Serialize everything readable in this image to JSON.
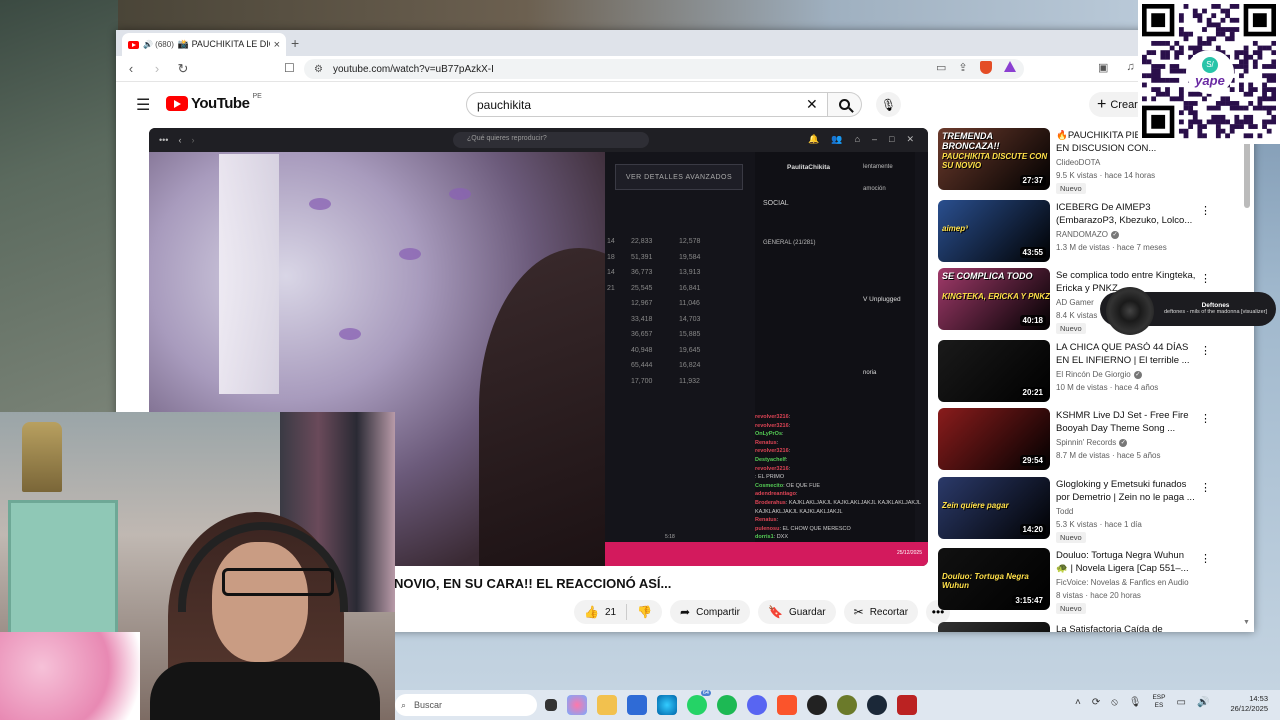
{
  "browser": {
    "tab": {
      "audio_badge": "🔊 (680)",
      "title": "📸 PAUCHIKITA LE DIC",
      "close": "×"
    },
    "new_tab": "+",
    "url": "youtube.com/watch?v=uB77pAzkX-I"
  },
  "youtube": {
    "logo_word": "YouTube",
    "country": "PE",
    "search_query": "pauchikita",
    "create_label": "Crear"
  },
  "player": {
    "inner_search_placeholder": "¿Qué quieres reproducir?",
    "advanced_btn": "VER DETALLES AVANZADOS",
    "profile_name": "PaulitaChikita",
    "social_label": "SOCIAL",
    "friends_label": "GENERAL (21/281)",
    "side_labels": [
      "lentamente",
      "amoción",
      "V Unplugged",
      "noria"
    ],
    "stat_col1": [
      "14",
      "18",
      "",
      "",
      "",
      "",
      "14",
      "",
      "",
      "",
      "",
      "21"
    ],
    "stat_col2": [
      "22,833",
      "51,391",
      "36,773",
      "25,545",
      "12,967",
      "",
      "33,418",
      "36,657",
      "40,948",
      "65,444",
      "17,700"
    ],
    "stat_col3": [
      "12,578",
      "19,584",
      "13,913",
      "16,841",
      "11,046",
      "",
      "14,703",
      "15,885",
      "19,645",
      "16,824",
      "11,932"
    ],
    "chat": [
      {
        "user": "revolver3216",
        "msg": ":"
      },
      {
        "user": "revolver3216",
        "msg": ":"
      },
      {
        "user": "OnLyPrOs",
        "msg": ":"
      },
      {
        "user": "Renatus",
        "msg": ":"
      },
      {
        "user": "revolver3216",
        "msg": ":"
      },
      {
        "user": "Destyachelf",
        "msg": ":"
      },
      {
        "user": "revolver3216",
        "msg": ":"
      },
      {
        "user": "",
        "msg": ": EL PRIMO"
      },
      {
        "user": "Cosmecito",
        "msg": ": OE QUE FUE"
      },
      {
        "user": "adendreantiago",
        "msg": ":"
      },
      {
        "user": "Broderahus",
        "msg": ": KAJKLAKLJAKJL KAJKLAKLJAKJL KAJKLAKLJAKJL"
      },
      {
        "user": "",
        "msg": "KAJKLAKLJAKJL KAJKLAKLJAKJL"
      },
      {
        "user": "Renatus",
        "msg": ":"
      },
      {
        "user": "pulenosu",
        "msg": ": EL CHOW QUE MERESCO"
      },
      {
        "user": "dorris1",
        "msg": ": DXX"
      }
    ],
    "time_small": "5:18",
    "date_small": "25/12/2025"
  },
  "video": {
    "title": "NOVIO, EN SU CARA!! EL REACCIONÓ ASÍ...",
    "likes": "21",
    "share_label": "Compartir",
    "save_label": "Guardar",
    "clip_label": "Recortar",
    "more": "•••"
  },
  "recommendations": [
    {
      "thumb_text": "TREMENDA BRONCAZA!!",
      "thumb_sub": "PAUCHIKITA DISCUTE CON SU NOVIO",
      "duration": "27:37",
      "title": "🔥PAUCHIKITA PIE CONTROL EN DISCUSION CON...",
      "channel": "ClideoDOTA",
      "meta": "9.5 K vistas · hace 14 horas",
      "badge": "Nuevo",
      "verified": false,
      "thumb_color": "#6b3a2c"
    },
    {
      "thumb_text": "",
      "thumb_sub": "aimep³",
      "duration": "43:55",
      "title": "ICEBERG De AIMEP3 (EmbarazoP3, Kbezuko, Lolco...",
      "channel": "RANDOMAZO",
      "meta": "1.3 M de vistas · hace 7 meses",
      "badge": "",
      "verified": true,
      "thumb_color": "#2a4f8f"
    },
    {
      "thumb_text": "SE COMPLICA TODO",
      "thumb_sub": "KINGTEKA, ERICKA Y PNKZ",
      "duration": "40:18",
      "title": "Se complica todo entre Kingteka, Ericka y PNKZ...",
      "channel": "AD Gamer",
      "meta": "8.4 K vistas",
      "badge": "Nuevo",
      "verified": false,
      "thumb_color": "#a03a6a"
    },
    {
      "thumb_text": "",
      "thumb_sub": "",
      "duration": "20:21",
      "title": "LA CHICA QUE PASÓ 44 DÍAS EN EL INFIERNO | El terrible ...",
      "channel": "El Rincón De Giorgio",
      "meta": "10 M de vistas · hace 4 años",
      "badge": "",
      "verified": true,
      "thumb_color": "#1a1a1a"
    },
    {
      "thumb_text": "",
      "thumb_sub": "",
      "duration": "29:54",
      "title": "KSHMR Live DJ Set - Free Fire Booyah Day Theme Song ...",
      "channel": "Spinnin' Records",
      "meta": "8.7 M de vistas · hace 5 años",
      "badge": "",
      "verified": true,
      "thumb_color": "#8a1c1c"
    },
    {
      "thumb_text": "",
      "thumb_sub": "Zein quiere pagar",
      "duration": "14:20",
      "title": "Glogloking y Emetsuki funados por Demetrio | Zein no le paga ...",
      "channel": "Todd",
      "meta": "5.3 K vistas · hace 1 día",
      "badge": "Nuevo",
      "verified": false,
      "thumb_color": "#2b3a6a"
    },
    {
      "thumb_text": "",
      "thumb_sub": "Douluo: Tortuga Negra Wuhun",
      "duration": "3:15:47",
      "title": "Douluo: Tortuga Negra Wuhun 🐢 | Novela Ligera [Cap 551–...",
      "channel": "FicVoice: Novelas & Fanfics en Audio",
      "meta": "8 vistas · hace 20 horas",
      "badge": "Nuevo",
      "verified": false,
      "thumb_color": "#111111"
    },
    {
      "thumb_text": "",
      "thumb_sub": "",
      "duration": "",
      "title": "La Satisfactoria Caída de",
      "channel": "",
      "meta": "",
      "badge": "",
      "verified": false,
      "thumb_color": "#333"
    }
  ],
  "music_widget": {
    "artist": "Deftones",
    "song": "deftones - mils of the madonna [visualizer]"
  },
  "yape": {
    "word": "yape",
    "symbol": "S/"
  },
  "taskbar": {
    "search_placeholder": "Buscar",
    "whatsapp_badge": "64",
    "lang_line1": "ESP",
    "lang_line2": "ES",
    "time": "14:53",
    "date": "26/12/2025"
  }
}
